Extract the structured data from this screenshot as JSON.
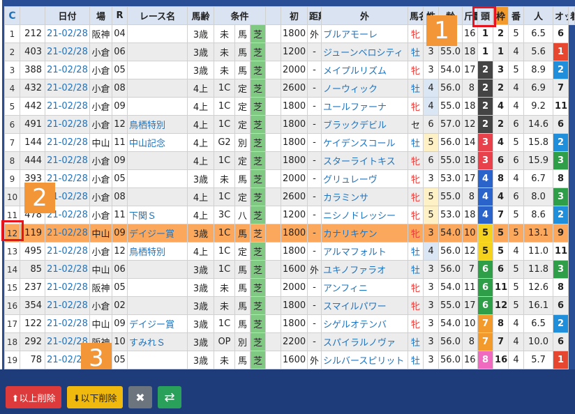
{
  "toolbar": {
    "delete_above_label": "⬆以上削除",
    "delete_below_label": "⬇以下削除",
    "clear_glyph": "✖",
    "swap_glyph": "⇄"
  },
  "callouts": [
    "1",
    "2",
    "3"
  ],
  "table": {
    "reload_glyph": "C",
    "columns": [
      "",
      "日付",
      "場",
      "R",
      "レース名",
      "馬齢",
      "条件",
      "",
      "",
      "初",
      "距離",
      "外",
      "馬名",
      "性",
      "齢",
      "斤量",
      "頭",
      "枠",
      "番",
      "人",
      "オッズ",
      "着"
    ],
    "rows": [
      {
        "idx": "1",
        "id": "212",
        "date": "21-02/28",
        "place": "阪神",
        "r": "04",
        "race": "",
        "age": "3歳",
        "cls": "未",
        "kind": "馬",
        "surf": "芝",
        "first": "",
        "dist": "1800",
        "out": "外",
        "horse": "ブルアモーレ",
        "sex": "牝",
        "hage": "3",
        "kin": "",
        "heads": "16",
        "waku": "1",
        "ban": "2",
        "nin": "5",
        "odds": "6.5",
        "chaku": "6",
        "wakuColor": "#ffffff",
        "wakuText": "#222",
        "chakuBg": "",
        "chakuText": "#222"
      },
      {
        "idx": "2",
        "id": "403",
        "date": "21-02/28",
        "place": "小倉",
        "r": "06",
        "race": "",
        "age": "3歳",
        "cls": "未",
        "kind": "馬",
        "surf": "芝",
        "first": "",
        "dist": "1200",
        "out": "-",
        "horse": "ジューンベロシティ",
        "sex": "牡",
        "hage": "3",
        "kin": "55.0",
        "heads": "18",
        "waku": "1",
        "ban": "1",
        "nin": "4",
        "odds": "5.6",
        "chaku": "1",
        "wakuColor": "#ffffff",
        "wakuText": "#222",
        "chakuBg": "#e8472f",
        "chakuText": "#fff"
      },
      {
        "idx": "3",
        "id": "388",
        "date": "21-02/28",
        "place": "小倉",
        "r": "05",
        "race": "",
        "age": "3歳",
        "cls": "未",
        "kind": "馬",
        "surf": "芝",
        "first": "",
        "dist": "2000",
        "out": "-",
        "horse": "メイプルリズム",
        "sex": "牝",
        "hage": "3",
        "kin": "54.0",
        "heads": "17",
        "waku": "2",
        "ban": "3",
        "nin": "5",
        "odds": "8.9",
        "chaku": "2",
        "wakuColor": "#444444",
        "wakuText": "#fff",
        "chakuBg": "#1f8fdc",
        "chakuText": "#fff"
      },
      {
        "idx": "4",
        "id": "432",
        "date": "21-02/28",
        "place": "小倉",
        "r": "08",
        "race": "",
        "age": "4上",
        "cls": "1C",
        "kind": "定",
        "surf": "芝",
        "first": "",
        "dist": "2600",
        "out": "-",
        "horse": "ノーウィック",
        "sex": "牡",
        "hage": "4",
        "kin": "56.0",
        "heads": "8",
        "waku": "2",
        "ban": "2",
        "nin": "4",
        "odds": "6.9",
        "chaku": "7",
        "wakuColor": "#444444",
        "wakuText": "#fff",
        "chakuBg": "",
        "chakuText": "#222"
      },
      {
        "idx": "5",
        "id": "442",
        "date": "21-02/28",
        "place": "小倉",
        "r": "09",
        "race": "",
        "age": "4上",
        "cls": "1C",
        "kind": "定",
        "surf": "芝",
        "first": "",
        "dist": "1800",
        "out": "-",
        "horse": "ユールファーナ",
        "sex": "牝",
        "hage": "4",
        "kin": "55.0",
        "heads": "18",
        "waku": "2",
        "ban": "4",
        "nin": "4",
        "odds": "9.2",
        "chaku": "11",
        "wakuColor": "#444444",
        "wakuText": "#fff",
        "chakuBg": "",
        "chakuText": "#222"
      },
      {
        "idx": "6",
        "id": "491",
        "date": "21-02/28",
        "place": "小倉",
        "r": "12",
        "race": "鳥栖特別",
        "age": "4上",
        "cls": "1C",
        "kind": "定",
        "surf": "芝",
        "first": "",
        "dist": "1800",
        "out": "-",
        "horse": "ブラックデビル",
        "sex": "セ",
        "hage": "6",
        "kin": "57.0",
        "heads": "12",
        "waku": "2",
        "ban": "2",
        "nin": "6",
        "odds": "14.6",
        "chaku": "6",
        "wakuColor": "#444444",
        "wakuText": "#fff",
        "chakuBg": "",
        "chakuText": "#222"
      },
      {
        "idx": "7",
        "id": "144",
        "date": "21-02/28",
        "place": "中山",
        "r": "11",
        "race": "中山記念",
        "age": "4上",
        "cls": "G2",
        "kind": "別",
        "surf": "芝",
        "first": "",
        "dist": "1800",
        "out": "-",
        "horse": "ケイデンスコール",
        "sex": "牡",
        "hage": "5",
        "kin": "56.0",
        "heads": "14",
        "waku": "3",
        "ban": "4",
        "nin": "5",
        "odds": "15.8",
        "chaku": "2",
        "wakuColor": "#e8414c",
        "wakuText": "#fff",
        "chakuBg": "#1f8fdc",
        "chakuText": "#fff"
      },
      {
        "idx": "8",
        "id": "444",
        "date": "21-02/28",
        "place": "小倉",
        "r": "09",
        "race": "",
        "age": "4上",
        "cls": "1C",
        "kind": "定",
        "surf": "芝",
        "first": "",
        "dist": "1800",
        "out": "-",
        "horse": "スターライトキス",
        "sex": "牝",
        "hage": "6",
        "kin": "55.0",
        "heads": "18",
        "waku": "3",
        "ban": "6",
        "nin": "6",
        "odds": "15.9",
        "chaku": "3",
        "wakuColor": "#e8414c",
        "wakuText": "#fff",
        "chakuBg": "#2e9e48",
        "chakuText": "#fff"
      },
      {
        "idx": "9",
        "id": "393",
        "date": "21-02/28",
        "place": "小倉",
        "r": "05",
        "race": "",
        "age": "3歳",
        "cls": "未",
        "kind": "馬",
        "surf": "芝",
        "first": "",
        "dist": "2000",
        "out": "-",
        "horse": "グリュレーヴ",
        "sex": "牝",
        "hage": "3",
        "kin": "53.0",
        "heads": "17",
        "waku": "4",
        "ban": "8",
        "nin": "4",
        "odds": "6.7",
        "chaku": "8",
        "wakuColor": "#2a63c9",
        "wakuText": "#fff",
        "chakuBg": "",
        "chakuText": "#222"
      },
      {
        "idx": "10",
        "id": "4",
        "date": "21-02/28",
        "place": "小倉",
        "r": "08",
        "race": "",
        "age": "4上",
        "cls": "1C",
        "kind": "定",
        "surf": "芝",
        "first": "",
        "dist": "2600",
        "out": "-",
        "horse": "カラミンサ",
        "sex": "牝",
        "hage": "5",
        "kin": "55.0",
        "heads": "8",
        "waku": "4",
        "ban": "4",
        "nin": "6",
        "odds": "8.0",
        "chaku": "3",
        "wakuColor": "#2a63c9",
        "wakuText": "#fff",
        "chakuBg": "#2e9e48",
        "chakuText": "#fff"
      },
      {
        "idx": "11",
        "id": "478",
        "date": "21-02/28",
        "place": "小倉",
        "r": "11",
        "race": "下関Ｓ",
        "age": "4上",
        "cls": "3C",
        "kind": "八",
        "surf": "芝",
        "first": "",
        "dist": "1200",
        "out": "-",
        "horse": "ニシノドレッシー",
        "sex": "牝",
        "hage": "5",
        "kin": "53.0",
        "heads": "18",
        "waku": "4",
        "ban": "7",
        "nin": "5",
        "odds": "8.6",
        "chaku": "2",
        "wakuColor": "#2a63c9",
        "wakuText": "#fff",
        "chakuBg": "#1f8fdc",
        "chakuText": "#fff"
      },
      {
        "idx": "12",
        "id": "119",
        "date": "21-02/28",
        "place": "中山",
        "r": "09",
        "race": "デイジー賞",
        "age": "3歳",
        "cls": "1C",
        "kind": "馬",
        "surf": "芝",
        "first": "",
        "dist": "1800",
        "out": "-",
        "horse": "カナリキケン",
        "sex": "牝",
        "hage": "3",
        "kin": "54.0",
        "heads": "10",
        "waku": "5",
        "ban": "5",
        "nin": "5",
        "odds": "13.1",
        "chaku": "9",
        "wakuColor": "#f5d31c",
        "wakuText": "#222",
        "chakuBg": "",
        "chakuText": "#222"
      },
      {
        "idx": "13",
        "id": "495",
        "date": "21-02/28",
        "place": "小倉",
        "r": "12",
        "race": "鳥栖特別",
        "age": "4上",
        "cls": "1C",
        "kind": "定",
        "surf": "芝",
        "first": "",
        "dist": "1800",
        "out": "-",
        "horse": "アルマフォルト",
        "sex": "牡",
        "hage": "4",
        "kin": "56.0",
        "heads": "12",
        "waku": "5",
        "ban": "5",
        "nin": "4",
        "odds": "11.0",
        "chaku": "11",
        "wakuColor": "#f5d31c",
        "wakuText": "#222",
        "chakuBg": "",
        "chakuText": "#222"
      },
      {
        "idx": "14",
        "id": "85",
        "date": "21-02/28",
        "place": "中山",
        "r": "06",
        "race": "",
        "age": "3歳",
        "cls": "1C",
        "kind": "馬",
        "surf": "芝",
        "first": "",
        "dist": "1600",
        "out": "外",
        "horse": "ユキノファラオ",
        "sex": "牡",
        "hage": "3",
        "kin": "56.0",
        "heads": "7",
        "waku": "6",
        "ban": "6",
        "nin": "5",
        "odds": "11.8",
        "chaku": "3",
        "wakuColor": "#2e9e48",
        "wakuText": "#fff",
        "chakuBg": "#2e9e48",
        "chakuText": "#fff"
      },
      {
        "idx": "15",
        "id": "237",
        "date": "21-02/28",
        "place": "阪神",
        "r": "05",
        "race": "",
        "age": "3歳",
        "cls": "未",
        "kind": "馬",
        "surf": "芝",
        "first": "",
        "dist": "2000",
        "out": "-",
        "horse": "アンフィニ",
        "sex": "牝",
        "hage": "3",
        "kin": "54.0",
        "heads": "11",
        "waku": "6",
        "ban": "11",
        "nin": "5",
        "odds": "12.6",
        "chaku": "8",
        "wakuColor": "#2e9e48",
        "wakuText": "#fff",
        "chakuBg": "",
        "chakuText": "#222"
      },
      {
        "idx": "16",
        "id": "354",
        "date": "21-02/28",
        "place": "小倉",
        "r": "02",
        "race": "",
        "age": "3歳",
        "cls": "未",
        "kind": "馬",
        "surf": "芝",
        "first": "",
        "dist": "1800",
        "out": "-",
        "horse": "スマイルパワー",
        "sex": "牝",
        "hage": "3",
        "kin": "55.0",
        "heads": "17",
        "waku": "6",
        "ban": "12",
        "nin": "5",
        "odds": "16.1",
        "chaku": "6",
        "wakuColor": "#2e9e48",
        "wakuText": "#fff",
        "chakuBg": "",
        "chakuText": "#222"
      },
      {
        "idx": "17",
        "id": "122",
        "date": "21-02/28",
        "place": "中山",
        "r": "09",
        "race": "デイジー賞",
        "age": "3歳",
        "cls": "1C",
        "kind": "馬",
        "surf": "芝",
        "first": "",
        "dist": "1800",
        "out": "-",
        "horse": "シゲルオテンバ",
        "sex": "牝",
        "hage": "3",
        "kin": "54.0",
        "heads": "10",
        "waku": "7",
        "ban": "8",
        "nin": "4",
        "odds": "6.5",
        "chaku": "2",
        "wakuColor": "#f39a2d",
        "wakuText": "#fff",
        "chakuBg": "#1f8fdc",
        "chakuText": "#fff"
      },
      {
        "idx": "18",
        "id": "292",
        "date": "21-02/28",
        "place": "阪神",
        "r": "10",
        "race": "すみれＳ",
        "age": "3歳",
        "cls": "OP",
        "kind": "別",
        "surf": "芝",
        "first": "",
        "dist": "2200",
        "out": "-",
        "horse": "スパイラルノヴァ",
        "sex": "牡",
        "hage": "3",
        "kin": "56.0",
        "heads": "8",
        "waku": "7",
        "ban": "7",
        "nin": "4",
        "odds": "10.0",
        "chaku": "6",
        "wakuColor": "#f39a2d",
        "wakuText": "#fff",
        "chakuBg": "",
        "chakuText": "#222"
      },
      {
        "idx": "19",
        "id": "78",
        "date": "21-02/28",
        "place": "中山",
        "r": "05",
        "race": "",
        "age": "3歳",
        "cls": "未",
        "kind": "馬",
        "surf": "芝",
        "first": "",
        "dist": "1600",
        "out": "外",
        "horse": "シルバースピリット",
        "sex": "牡",
        "hage": "3",
        "kin": "56.0",
        "heads": "16",
        "waku": "8",
        "ban": "16",
        "nin": "4",
        "odds": "5.7",
        "chaku": "1",
        "wakuColor": "#f06ac0",
        "wakuText": "#fff",
        "chakuBg": "#e8472f",
        "chakuText": "#fff"
      }
    ]
  }
}
